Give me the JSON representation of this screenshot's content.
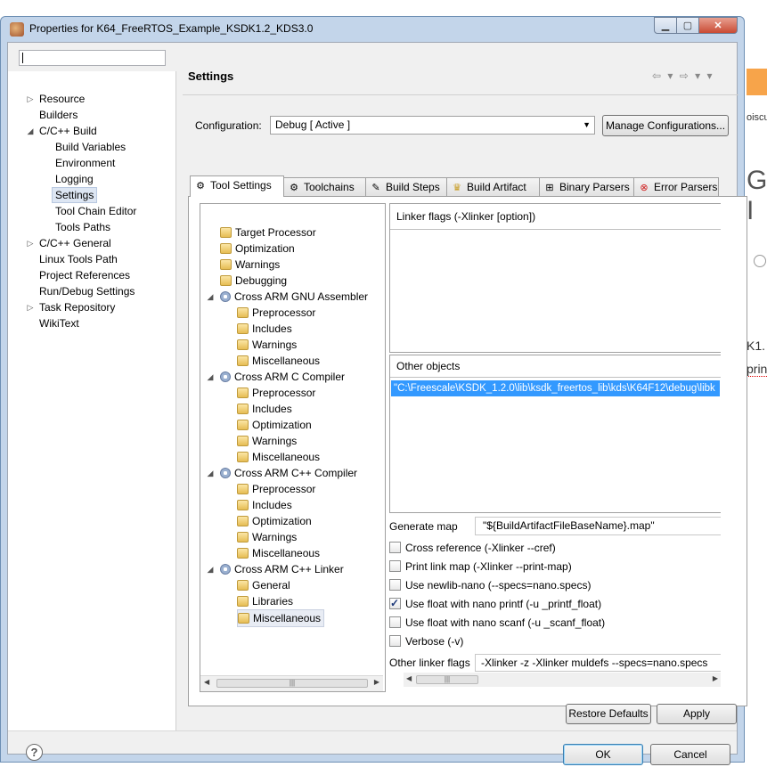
{
  "window": {
    "title": "Properties for K64_FreeRTOS_Example_KSDK1.2_KDS3.0"
  },
  "nav": {
    "filter_value": "",
    "items": [
      {
        "label": "Resource",
        "expandable": true
      },
      {
        "label": "Builders"
      },
      {
        "label": "C/C++ Build",
        "expanded": true
      },
      {
        "label": "Build Variables"
      },
      {
        "label": "Environment"
      },
      {
        "label": "Logging"
      },
      {
        "label": "Settings",
        "selected": true
      },
      {
        "label": "Tool Chain Editor"
      },
      {
        "label": "Tools Paths"
      },
      {
        "label": "C/C++ General",
        "expandable": true
      },
      {
        "label": "Linux Tools Path"
      },
      {
        "label": "Project References"
      },
      {
        "label": "Run/Debug Settings"
      },
      {
        "label": "Task Repository",
        "expandable": true
      },
      {
        "label": "WikiText"
      }
    ]
  },
  "settings": {
    "title": "Settings",
    "config_label": "Configuration:",
    "config_value": "Debug  [ Active ]",
    "manage_btn": "Manage Configurations..."
  },
  "tabs": [
    {
      "label": "Tool Settings",
      "active": true,
      "icon": "gear-icon"
    },
    {
      "label": "Toolchains",
      "icon": "gear-icon"
    },
    {
      "label": "Build Steps",
      "icon": "wrench-icon"
    },
    {
      "label": "Build Artifact",
      "icon": "trophy-icon"
    },
    {
      "label": "Binary Parsers",
      "icon": "binary-icon"
    },
    {
      "label": "Error Parsers",
      "icon": "error-icon"
    }
  ],
  "tool_tree": [
    {
      "label": "Target Processor",
      "icon": "folder-icon"
    },
    {
      "label": "Optimization",
      "icon": "folder-icon"
    },
    {
      "label": "Warnings",
      "icon": "folder-icon"
    },
    {
      "label": "Debugging",
      "icon": "folder-icon"
    },
    {
      "label": "Cross ARM GNU Assembler",
      "icon": "gear-icon"
    },
    {
      "label": "Preprocessor",
      "icon": "folder-icon"
    },
    {
      "label": "Includes",
      "icon": "folder-icon"
    },
    {
      "label": "Warnings",
      "icon": "folder-icon"
    },
    {
      "label": "Miscellaneous",
      "icon": "folder-icon"
    },
    {
      "label": "Cross ARM C Compiler",
      "icon": "gear-icon"
    },
    {
      "label": "Preprocessor",
      "icon": "folder-icon"
    },
    {
      "label": "Includes",
      "icon": "folder-icon"
    },
    {
      "label": "Optimization",
      "icon": "folder-icon"
    },
    {
      "label": "Warnings",
      "icon": "folder-icon"
    },
    {
      "label": "Miscellaneous",
      "icon": "folder-icon"
    },
    {
      "label": "Cross ARM C++ Compiler",
      "icon": "gear-icon"
    },
    {
      "label": "Preprocessor",
      "icon": "folder-icon"
    },
    {
      "label": "Includes",
      "icon": "folder-icon"
    },
    {
      "label": "Optimization",
      "icon": "folder-icon"
    },
    {
      "label": "Warnings",
      "icon": "folder-icon"
    },
    {
      "label": "Miscellaneous",
      "icon": "folder-icon"
    },
    {
      "label": "Cross ARM C++ Linker",
      "icon": "gear-icon"
    },
    {
      "label": "General",
      "icon": "folder-icon"
    },
    {
      "label": "Libraries",
      "icon": "folder-icon"
    },
    {
      "label": "Miscellaneous",
      "icon": "folder-icon",
      "selected": true
    }
  ],
  "linker": {
    "flags_header": "Linker flags (-Xlinker [option])",
    "other_objects_header": "Other objects",
    "other_objects_item": "\"C:\\Freescale\\KSDK_1.2.0\\lib\\ksdk_freertos_lib\\kds\\K64F12\\debug\\libk",
    "generate_map_label": "Generate map",
    "generate_map_value": "\"${BuildArtifactFileBaseName}.map\"",
    "checkboxes": [
      {
        "label": "Cross reference (-Xlinker --cref)",
        "checked": false
      },
      {
        "label": "Print link map (-Xlinker --print-map)",
        "checked": false
      },
      {
        "label": "Use newlib-nano (--specs=nano.specs)",
        "checked": false
      },
      {
        "label": "Use float with nano printf (-u _printf_float)",
        "checked": true
      },
      {
        "label": "Use float with nano scanf (-u _scanf_float)",
        "checked": false
      },
      {
        "label": "Verbose (-v)",
        "checked": false
      }
    ],
    "other_flags_label": "Other linker flags",
    "other_flags_value": "-Xlinker -z  -Xlinker muldefs  --specs=nano.specs"
  },
  "buttons": {
    "restore": "Restore Defaults",
    "apply": "Apply",
    "ok": "OK",
    "cancel": "Cancel"
  },
  "background": {
    "t1": "oiscu",
    "t2": "G I",
    "t3": "K1.",
    "t4": "prin"
  },
  "colors": {
    "selection": "#3399ff",
    "window_frame": "#c3d5ea",
    "close_button": "#c94b34"
  }
}
